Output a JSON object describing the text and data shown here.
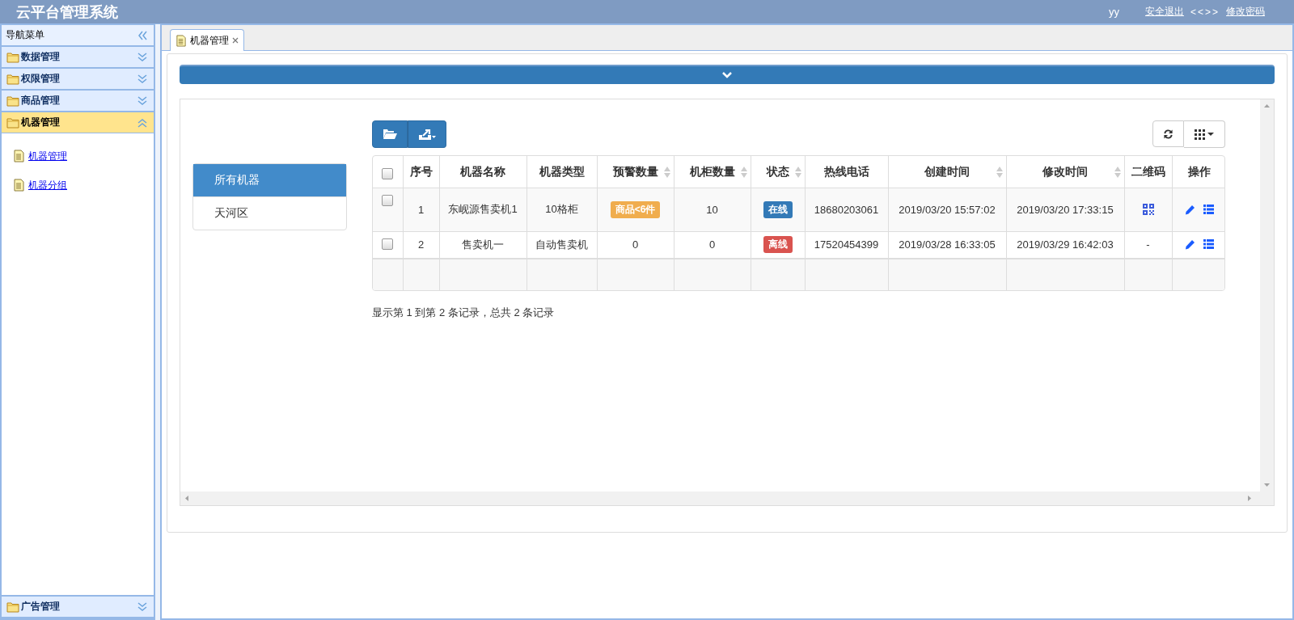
{
  "header": {
    "title": "云平台管理系统",
    "user": "yy",
    "links": [
      {
        "kind": "link",
        "label": "安全退出"
      },
      {
        "kind": "text",
        "label": "<<>>"
      },
      {
        "kind": "link",
        "label": "修改密码"
      }
    ]
  },
  "sidebar": {
    "title": "导航菜单",
    "sections": [
      {
        "label": "数据管理",
        "expanded": false
      },
      {
        "label": "权限管理",
        "expanded": false
      },
      {
        "label": "商品管理",
        "expanded": false
      },
      {
        "label": "机器管理",
        "expanded": true,
        "children": [
          {
            "label": "机器管理"
          },
          {
            "label": "机器分组"
          }
        ]
      },
      {
        "label": "广告管理",
        "expanded": false
      }
    ]
  },
  "tabs": [
    {
      "label": "机器管理",
      "selected": true
    }
  ],
  "groups": [
    {
      "label": "所有机器",
      "selected": true
    },
    {
      "label": "天河区",
      "selected": false
    }
  ],
  "table": {
    "columns": [
      {
        "kind": "check",
        "checked": false
      },
      {
        "label": "序号",
        "sortable": false
      },
      {
        "label": "机器名称",
        "sortable": false
      },
      {
        "label": "机器类型",
        "sortable": false
      },
      {
        "label": "预警数量",
        "sortable": true
      },
      {
        "label": "机柜数量",
        "sortable": true
      },
      {
        "label": "状态",
        "sortable": true
      },
      {
        "label": "热线电话",
        "sortable": false
      },
      {
        "label": "创建时间",
        "sortable": true
      },
      {
        "label": "修改时间",
        "sortable": true
      },
      {
        "label": "二维码",
        "sortable": false
      },
      {
        "label": "操作",
        "sortable": false
      }
    ],
    "rows": [
      {
        "cells": [
          {
            "kind": "check",
            "checked": false
          },
          {
            "kind": "text",
            "text": "1"
          },
          {
            "kind": "text",
            "text": "东岘源售卖机1"
          },
          {
            "kind": "text",
            "text": "10格柜"
          },
          {
            "kind": "badge",
            "text": "商品<6件",
            "color": "#f0ad4e"
          },
          {
            "kind": "text",
            "text": "10"
          },
          {
            "kind": "badge",
            "text": "在线",
            "color": "#337ab7"
          },
          {
            "kind": "text",
            "text": "18680203061"
          },
          {
            "kind": "text",
            "text": "2019/03/20 15:57:02"
          },
          {
            "kind": "text",
            "text": "2019/03/20 17:33:15"
          },
          {
            "kind": "qr"
          },
          {
            "kind": "actions"
          }
        ]
      },
      {
        "cells": [
          {
            "kind": "check",
            "checked": false
          },
          {
            "kind": "text",
            "text": "2"
          },
          {
            "kind": "text",
            "text": "售卖机一"
          },
          {
            "kind": "text",
            "text": "自动售卖机"
          },
          {
            "kind": "text",
            "text": "0"
          },
          {
            "kind": "text",
            "text": "0"
          },
          {
            "kind": "badge",
            "text": "离线",
            "color": "#d9534f"
          },
          {
            "kind": "text",
            "text": "17520454399"
          },
          {
            "kind": "text",
            "text": "2019/03/28 16:33:05"
          },
          {
            "kind": "text",
            "text": "2019/03/29 16:42:03"
          },
          {
            "kind": "text",
            "text": "-"
          },
          {
            "kind": "actions"
          }
        ]
      }
    ]
  },
  "pagination": "显示第 1 到第 2 条记录，总共 2 条记录"
}
